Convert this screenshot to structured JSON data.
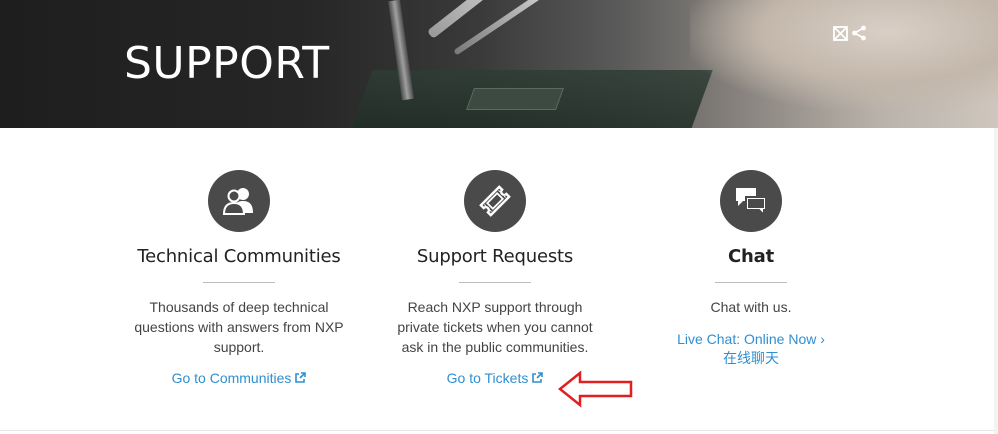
{
  "hero": {
    "title": "SUPPORT",
    "icons": [
      "email-icon",
      "share-icon"
    ]
  },
  "columns": [
    {
      "icon": "user-community-icon",
      "title": "Technical Communities",
      "description": "Thousands of deep technical questions with answers from NXP support.",
      "link": "Go to Communities",
      "link_icon": "external-link-icon"
    },
    {
      "icon": "ticket-icon",
      "title": "Support Requests",
      "description": "Reach NXP support through private tickets when you cannot ask in the public communities.",
      "link": "Go to Tickets",
      "link_icon": "external-link-icon"
    },
    {
      "icon": "chat-bubbles-icon",
      "title": "Chat",
      "description": "Chat with us.",
      "link": "Live Chat: Online Now",
      "link_suffix": "›",
      "link_secondary": "在线聊天"
    }
  ],
  "annotation": {
    "icon": "red-arrow-left-icon",
    "color": "#e02020"
  },
  "colors": {
    "link": "#2f8fd0",
    "icon_circle": "#4a4a4a"
  }
}
